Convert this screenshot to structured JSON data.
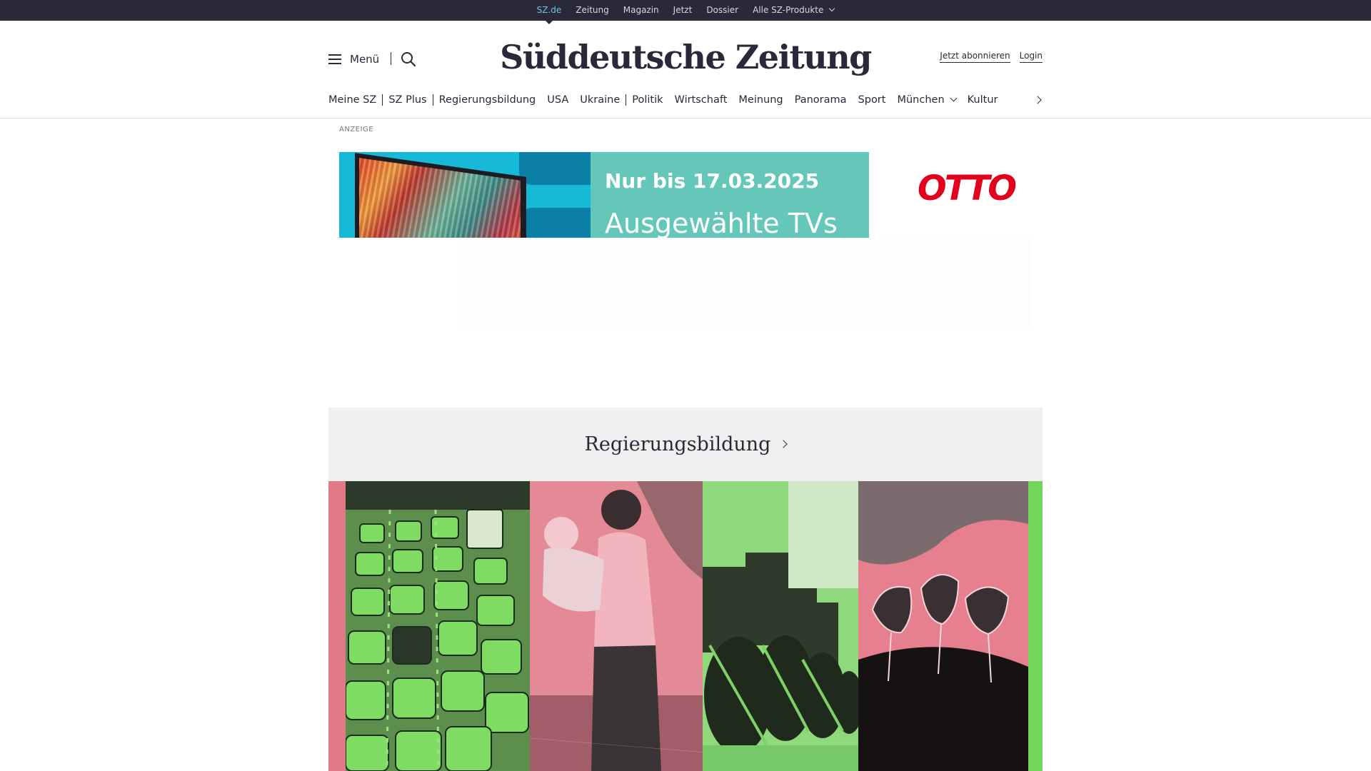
{
  "top_nav": {
    "items": [
      {
        "label": "SZ.de",
        "active": true
      },
      {
        "label": "Zeitung",
        "active": false
      },
      {
        "label": "Magazin",
        "active": false
      },
      {
        "label": "Jetzt",
        "active": false
      },
      {
        "label": "Dossier",
        "active": false
      },
      {
        "label": "Alle SZ-Produkte",
        "active": false,
        "dropdown": true
      }
    ]
  },
  "header": {
    "menu_label": "Menü",
    "logo_text": "Süddeutsche Zeitung",
    "subscribe_label": "Jetzt abonnieren",
    "login_label": "Login"
  },
  "main_nav": {
    "items": [
      "Meine SZ",
      "SZ Plus",
      "Regierungsbildung",
      "USA",
      "Ukraine",
      "Politik",
      "Wirtschaft",
      "Meinung",
      "Panorama",
      "Sport",
      "München",
      "Kultur"
    ]
  },
  "ad": {
    "label": "ANZEIGE",
    "headline": "Nur bis 17.03.2025",
    "subline": "Ausgewählte TVs",
    "brand": "OTTO"
  },
  "section": {
    "title": "Regierungsbildung"
  },
  "colors": {
    "dark": "#29293a",
    "accent_active": "#6fc7d3",
    "ad_teal": "#64c7b9",
    "otto_red": "#e3001b",
    "collage_pink": "#e07a86",
    "collage_green": "#72d65c",
    "section_bg": "#f0f0f0"
  },
  "icons": [
    "hamburger-icon",
    "search-icon",
    "chevron-down-icon",
    "chevron-right-icon"
  ]
}
